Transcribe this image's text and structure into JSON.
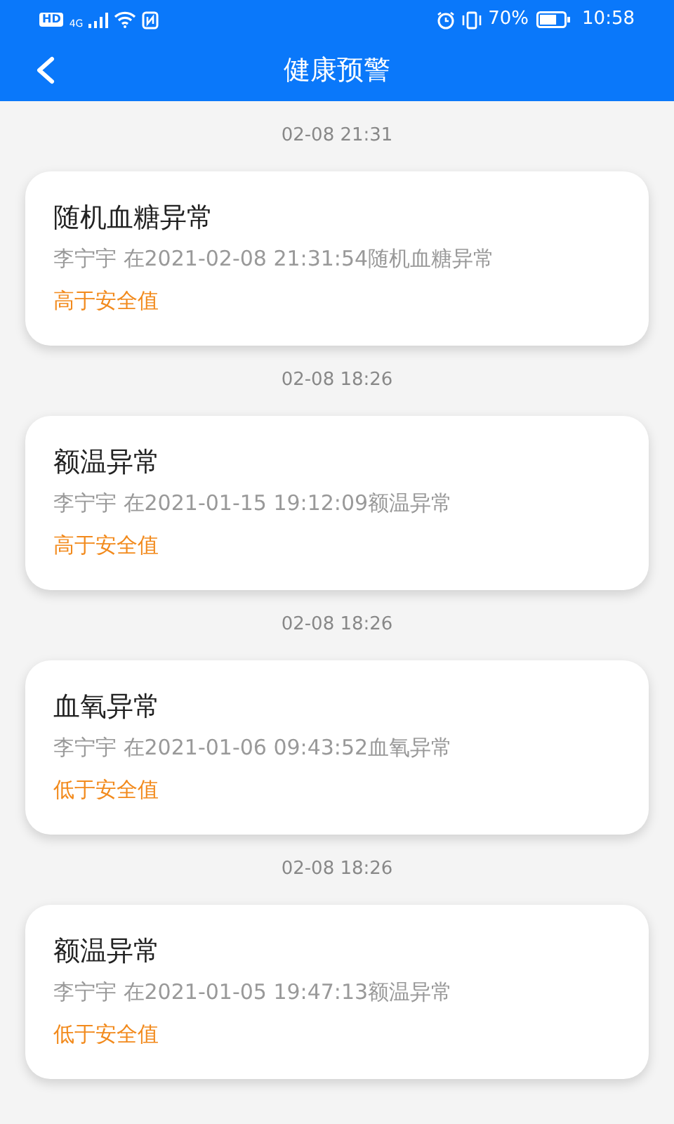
{
  "status_bar": {
    "left_badges": [
      "HD",
      "4G"
    ],
    "battery": "70%",
    "time": "10:58"
  },
  "header": {
    "title": "健康预警"
  },
  "alerts": [
    {
      "date": "02-08 21:31",
      "title": "随机血糖异常",
      "detail": "李宁宇 在2021-02-08 21:31:54随机血糖异常",
      "status": "高于安全值"
    },
    {
      "date": "02-08 18:26",
      "title": "额温异常",
      "detail": "李宁宇 在2021-01-15 19:12:09额温异常",
      "status": "高于安全值"
    },
    {
      "date": "02-08 18:26",
      "title": "血氧异常",
      "detail": "李宁宇 在2021-01-06 09:43:52血氧异常",
      "status": "低于安全值"
    },
    {
      "date": "02-08 18:26",
      "title": "额温异常",
      "detail": "李宁宇 在2021-01-05 19:47:13额温异常",
      "status": "低于安全值"
    }
  ]
}
